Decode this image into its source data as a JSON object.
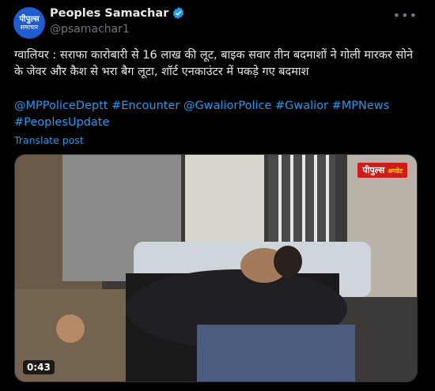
{
  "author": {
    "avatar_line1": "पीपुल्स",
    "avatar_line2": "समाचार",
    "name": "Peoples Samachar",
    "handle": "@psamachar1"
  },
  "more_icon": "ellipsis-icon",
  "post": {
    "text": "ग्वालियर : सराफा कारोबारी से 16 लाख की लूट, बाइक सवार तीन बदमाशों ने गोली मारकर सोने के जेवर और कैश से भरा बैग लूटा, शॉर्ट एनकाउंटर में पकड़े गए बदमाश",
    "hashtags": "@MPPoliceDeptt #Encounter @GwaliorPolice #Gwalior #MPNews #PeoplesUpdate",
    "translate": "Translate post"
  },
  "video": {
    "duration": "0:43",
    "watermark_main": "पीपुल्स",
    "watermark_sub": "अपडेट"
  },
  "colors": {
    "accent": "#1d9bf0",
    "background": "#000000",
    "text": "#e7e9ea",
    "muted": "#71767b"
  }
}
